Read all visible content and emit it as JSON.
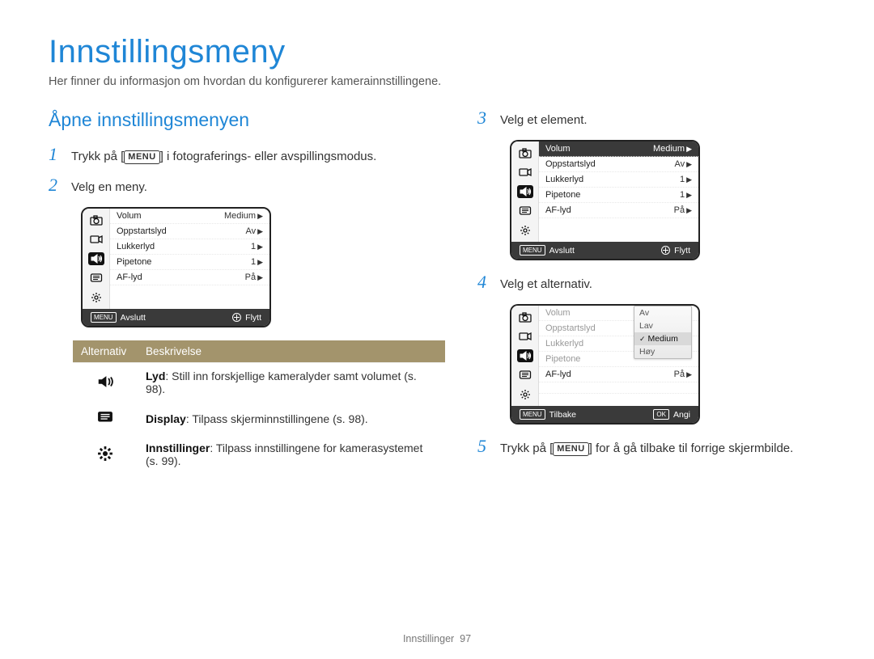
{
  "title": "Innstillingsmeny",
  "intro": "Her finner du informasjon om hvordan du konfigurerer kamerainnstillingene.",
  "section": "Åpne innstillingsmenyen",
  "menu_label": "MENU",
  "steps": {
    "s1_pre": "Trykk på [",
    "s1_post": "] i fotograferings- eller avspillingsmodus.",
    "s2": "Velg en meny.",
    "s3": "Velg et element.",
    "s4": "Velg et alternativ.",
    "s5_pre": "Trykk på [",
    "s5_post": "] for å gå tilbake til forrige skjermbilde."
  },
  "lcd_common": {
    "rows": {
      "volum": "Volum",
      "oppstartslyd": "Oppstartslyd",
      "lukkerlyd": "Lukkerlyd",
      "pipetone": "Pipetone",
      "aflyd": "AF-lyd"
    },
    "vals": {
      "medium": "Medium",
      "av": "Av",
      "one": "1",
      "pa": "På"
    },
    "exit": "Avslutt",
    "move": "Flytt",
    "back": "Tilbake",
    "set": "Angi",
    "ok": "OK",
    "menu": "MENU"
  },
  "dropdown": {
    "av": "Av",
    "lav": "Lav",
    "medium": "Medium",
    "hoy": "Høy"
  },
  "table": {
    "h1": "Alternativ",
    "h2": "Beskrivelse",
    "r1_b": "Lyd",
    "r1_t": ": Still inn forskjellige kameralyder samt volumet (s. 98).",
    "r2_b": "Display",
    "r2_t": ": Tilpass skjerminnstillingene (s. 98).",
    "r3_b": "Innstillinger",
    "r3_t": ": Tilpass innstillingene for kamerasystemet (s. 99)."
  },
  "footer": {
    "label": "Innstillinger",
    "page": "97"
  }
}
